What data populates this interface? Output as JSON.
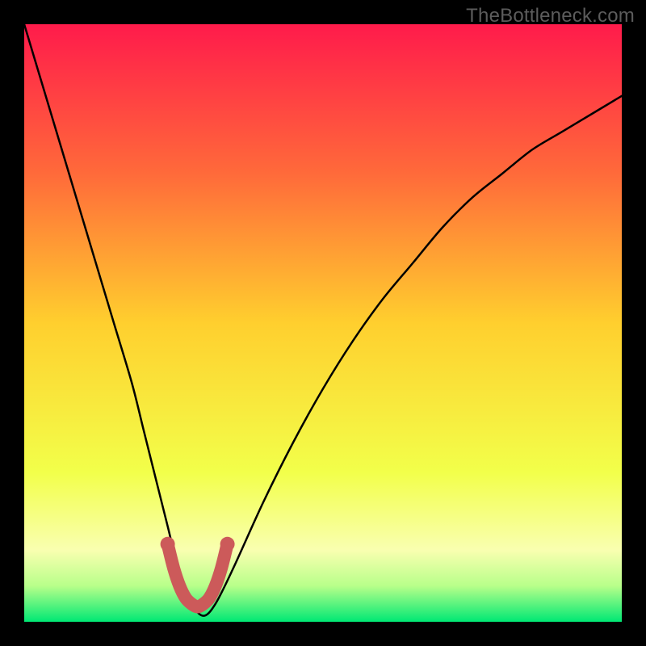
{
  "watermark": {
    "text": "TheBottleneck.com"
  },
  "chart_data": {
    "type": "line",
    "title": "",
    "xlabel": "",
    "ylabel": "",
    "xlim": [
      0,
      100
    ],
    "ylim": [
      0,
      100
    ],
    "grid": false,
    "legend": false,
    "background_gradient": {
      "stops": [
        {
          "pos": 0.0,
          "color": "#ff1b4b"
        },
        {
          "pos": 0.25,
          "color": "#ff6a3a"
        },
        {
          "pos": 0.5,
          "color": "#ffcf2e"
        },
        {
          "pos": 0.75,
          "color": "#f2ff4a"
        },
        {
          "pos": 0.88,
          "color": "#f9ffb0"
        },
        {
          "pos": 0.94,
          "color": "#b8ff8a"
        },
        {
          "pos": 1.0,
          "color": "#00e874"
        }
      ]
    },
    "series": [
      {
        "name": "bottleneck-curve",
        "color": "#000000",
        "x": [
          0,
          3,
          6,
          9,
          12,
          15,
          18,
          20,
          22,
          24,
          26,
          28,
          30,
          32,
          35,
          40,
          45,
          50,
          55,
          60,
          65,
          70,
          75,
          80,
          85,
          90,
          95,
          100
        ],
        "y": [
          100,
          90,
          80,
          70,
          60,
          50,
          40,
          32,
          24,
          16,
          8,
          3,
          1,
          3,
          9,
          20,
          30,
          39,
          47,
          54,
          60,
          66,
          71,
          75,
          79,
          82,
          85,
          88
        ]
      },
      {
        "name": "optimal-band",
        "color": "#cc5a5a",
        "style": "thick",
        "x": [
          24,
          25,
          26,
          27,
          28,
          29,
          30,
          31,
          32,
          33,
          34
        ],
        "y": [
          13,
          9,
          6,
          4,
          3,
          2.5,
          3,
          4,
          6,
          9,
          13
        ]
      }
    ]
  }
}
